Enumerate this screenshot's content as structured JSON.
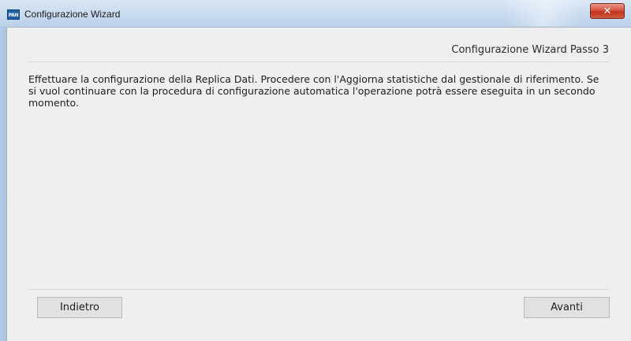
{
  "window": {
    "title": "Configurazione Wizard",
    "icon_label": "PAN",
    "close_glyph": "✕"
  },
  "wizard": {
    "step_title": "Configurazione Wizard Passo 3",
    "description": "Effettuare la configurazione della Replica Dati. Procedere con l'Aggiorna statistiche dal gestionale di riferimento. Se si vuol continuare con la procedura di configurazione automatica l'operazione potrà essere eseguita in un secondo momento.",
    "back_label": "Indietro",
    "next_label": "Avanti"
  },
  "icons": {
    "app": "app-icon",
    "close": "close-icon"
  },
  "colors": {
    "titlebar": "#c6d9ef",
    "client_background": "#efefef",
    "close_button": "#c2321d",
    "button_face": "#e1e1e1"
  }
}
